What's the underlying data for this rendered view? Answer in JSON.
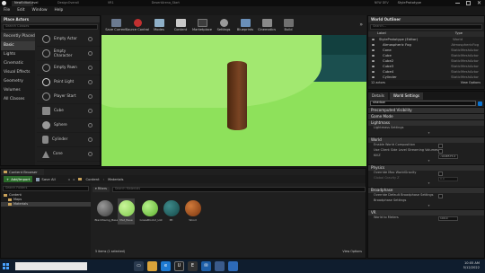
{
  "titlebar": {
    "tabs": [
      "NewEditorLevel",
      "DesignOverall",
      "VR1",
      "DesertArena_Start"
    ],
    "project": "StylePrototype",
    "info_label": "NEW DEV"
  },
  "menu": [
    "File",
    "Edit",
    "Window",
    "Help"
  ],
  "toolbar": [
    "Save Current",
    "Source Control",
    "Modes",
    "Content",
    "Marketplace",
    "Settings",
    "Blueprints",
    "Cinematics",
    "Build"
  ],
  "place_actors": {
    "title": "Place Actors",
    "search_placeholder": "Search Classes",
    "categories": [
      "Recently Placed",
      "Basic",
      "Lights",
      "Cinematic",
      "Visual Effects",
      "Geometry",
      "Volumes",
      "All Classes"
    ],
    "items": [
      "Empty Actor",
      "Empty Character",
      "Empty Pawn",
      "Point Light",
      "Player Start",
      "Cube",
      "Sphere",
      "Cylinder",
      "Cone"
    ]
  },
  "content_browser": {
    "tab": "Content Browser",
    "add_label": "Add/Import",
    "save_label": "Save All",
    "path": [
      "Content",
      "Materials"
    ],
    "search_placeholder": "Search Materials",
    "tree_search_placeholder": "Search Folders",
    "filters_label": "Filters",
    "tree": [
      "Content",
      "Maps",
      "Materials"
    ],
    "assets": [
      "BlackSwing_Base",
      "Mat_Base",
      "GrassBlock2_LGt",
      "Mt",
      "Wood"
    ],
    "status": "5 items (1 selected)",
    "view_options": "View Options"
  },
  "outliner": {
    "title": "World Outliner",
    "search_placeholder": "Search...",
    "col_label": "Label",
    "col_type": "Type",
    "rows": [
      {
        "label": "StylePrototype (Editor)",
        "type": "World"
      },
      {
        "label": "Atmospheric Fog",
        "type": "AtmosphericFog"
      },
      {
        "label": "Cone",
        "type": "StaticMeshActor"
      },
      {
        "label": "Cube",
        "type": "StaticMeshActor"
      },
      {
        "label": "Cube2",
        "type": "StaticMeshActor"
      },
      {
        "label": "Cube3",
        "type": "StaticMeshActor"
      },
      {
        "label": "Cube4",
        "type": "StaticMeshActor"
      },
      {
        "label": "Cylinder",
        "type": "StaticMeshActor"
      }
    ],
    "count": "12 actors",
    "view_options": "View Options"
  },
  "details": {
    "tab1": "Details",
    "tab2": "World Settings",
    "search_value": "shadow",
    "sections": [
      "Precomputed Visibility",
      "Game Mode",
      "Lightmass",
      "World",
      "Physics",
      "Broadphase",
      "VR"
    ],
    "lightmass_prop": "Lightmass Settings",
    "world_props": [
      "Enable World Composition",
      "Use Client Side Level Streaming Volumes",
      "KillZ"
    ],
    "killz_value": "-1048575.0",
    "physics_props": [
      "Override Max WorldGravity",
      "Global Gravity Z"
    ],
    "gravity_value": "0.0",
    "broad_props": [
      "Override Default Broadphase Settings",
      "Broadphase Settings"
    ],
    "vr_props": [
      "World to Meters"
    ],
    "vr_value": "100.0"
  },
  "taskbar": {
    "time": "10:05 AM",
    "date": "5/12/2022"
  },
  "colors": {
    "sky": "#1b4f4f",
    "canopy": "#a2e870",
    "ground": "#8ee15b",
    "trunk": "#6b3a1e",
    "accent": "#0b73d0"
  }
}
